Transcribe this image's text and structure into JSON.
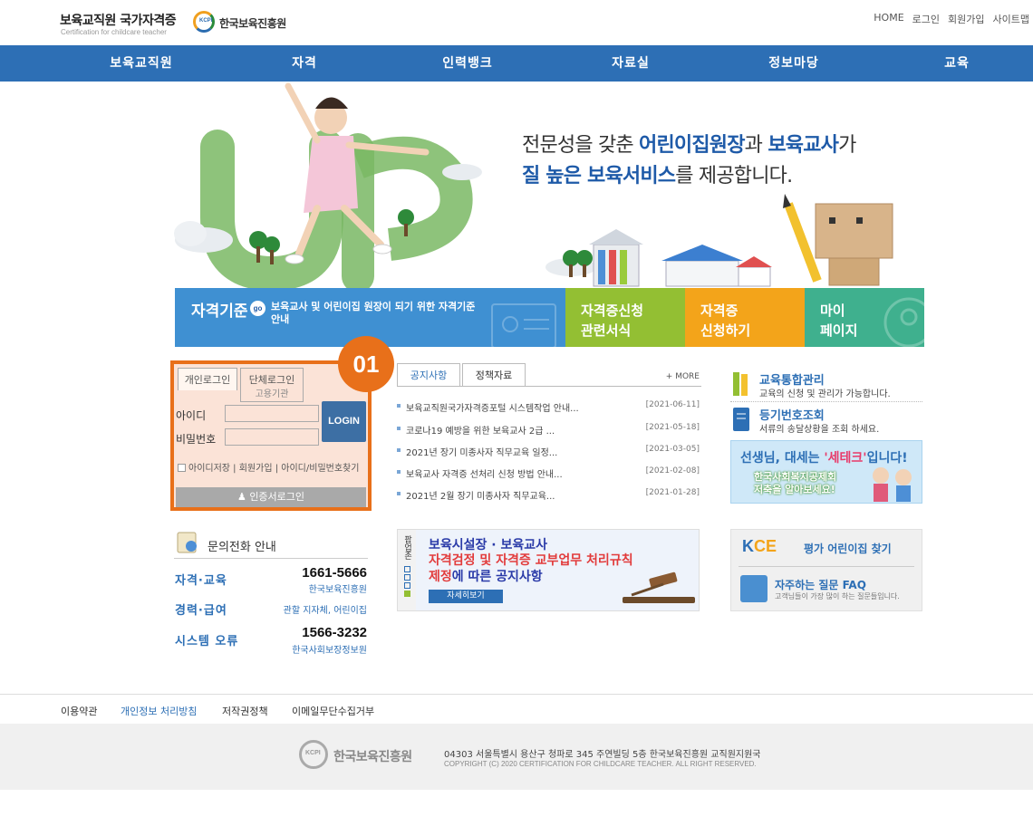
{
  "header": {
    "site_title": "보육교직원 국가자격증",
    "site_subtitle": "Certification for childcare teacher",
    "org_logo_text": "KCPI",
    "org_name": "한국보육진흥원",
    "util_nav": [
      "HOME",
      "로그인",
      "회원가입",
      "사이트맵"
    ]
  },
  "gnb": [
    "보육교직원",
    "자격",
    "인력뱅크",
    "자료실",
    "정보마당",
    "교육"
  ],
  "hero": {
    "line1_a": "전문성을 갖춘 ",
    "line1_b": "어린이집원장",
    "line1_c": "과 ",
    "line1_d": "보육교사",
    "line1_e": "가",
    "line2_a": "질 높은 보육서비스",
    "line2_b": "를 제공합니다."
  },
  "quick_menu": {
    "standard_title": "자격기준",
    "go": "go",
    "standard_desc": "보육교사 및 어린이집 원장이 되기 위한 자격기준 안내",
    "forms_line1": "자격증신청",
    "forms_line2": "관련서식",
    "apply_line1": "자격증",
    "apply_line2": "신청하기",
    "mypage_line1": "마이",
    "mypage_line2": "페이지"
  },
  "login": {
    "number_badge": "01",
    "tab_personal": "개인로그인",
    "tab_group": "단체로그인",
    "tab_job": "고용기관",
    "id_label": "아이디",
    "pw_label": "비밀번호",
    "login_button": "LOGIN",
    "save_id": "아이디저장",
    "join": "회원가입",
    "find": "아이디/비밀번호찾기",
    "cert_login": "인증서로그인"
  },
  "board": {
    "tab_notice": "공지사항",
    "tab_policy": "정책자료",
    "more": "+ MORE",
    "rows": [
      {
        "title": "보육교직원국가자격증포털 시스템작업 안내...",
        "date": "[2021-06-11]"
      },
      {
        "title": "코로나19 예방을 위한 보육교사 2급 ...",
        "date": "[2021-05-18]"
      },
      {
        "title": "2021년 장기 미종사자 직무교육 일정...",
        "date": "[2021-03-05]"
      },
      {
        "title": "보육교사 자격증 선처리 신청 방법 안내...",
        "date": "[2021-02-08]"
      },
      {
        "title": "2021년 2월 장기 미종사자 직무교육...",
        "date": "[2021-01-28]"
      }
    ]
  },
  "right_links": {
    "edu_title": "교육통합관리",
    "edu_desc": "교육의 신청 및 관리가 가능합니다.",
    "reg_title": "등기번호조회",
    "reg_desc": "서류의 송달상황을 조회 하세요."
  },
  "banner_teacher": {
    "title_a": "선생님, 대세는 ",
    "title_b": "'세테크'",
    "title_c": "입니다!",
    "sub1": "한국사회복지공제회",
    "sub2": "저축을 알아보세요!"
  },
  "contact": {
    "title": "문의전화 안내",
    "rows": [
      {
        "label": "자격·교육",
        "number": "1661-5666",
        "org": "한국보육진흥원"
      },
      {
        "label": "경력·급여",
        "number": "",
        "org": "관할 지자체, 어린이집"
      },
      {
        "label": "시스템 오류",
        "number": "1566-3232",
        "org": "한국사회보장정보원"
      }
    ]
  },
  "popup": {
    "label": "팝업존",
    "line1": "보육시설장 · 보육교사",
    "line2": "자격검정 및 자격증 교부업무 처리규칙",
    "line3_a": "제정",
    "line3_b": "에 따른 공지사항",
    "button": "자세히보기"
  },
  "right_box": {
    "kce_k": "K",
    "kce_ce": "CE",
    "kce_label": "평가 어린이집 찾기",
    "faq_title": "자주하는 질문 FAQ",
    "faq_desc": "고객님들이 가장 많이 하는 질문들입니다."
  },
  "footer_links": [
    "이용약관",
    "개인정보 처리방침",
    "저작권정책",
    "이메일무단수집거부"
  ],
  "footer": {
    "logo_text": "KCPI",
    "org": "한국보육진흥원",
    "address": "04303 서울특별시 용산구 청파로 345 주연빌딩 5층 한국보육진흥원 교직원지원국",
    "copyright": "COPYRIGHT (C) 2020 CERTIFICATION FOR CHILDCARE TEACHER. ALL RIGHT RESERVED."
  },
  "colors": {
    "primary": "#2d6fb5",
    "highlight_orange": "#e8701a",
    "qm_blue": "#3f90d2",
    "qm_green": "#93bf33",
    "qm_orange": "#f3a41a",
    "qm_teal": "#3fb08e"
  }
}
